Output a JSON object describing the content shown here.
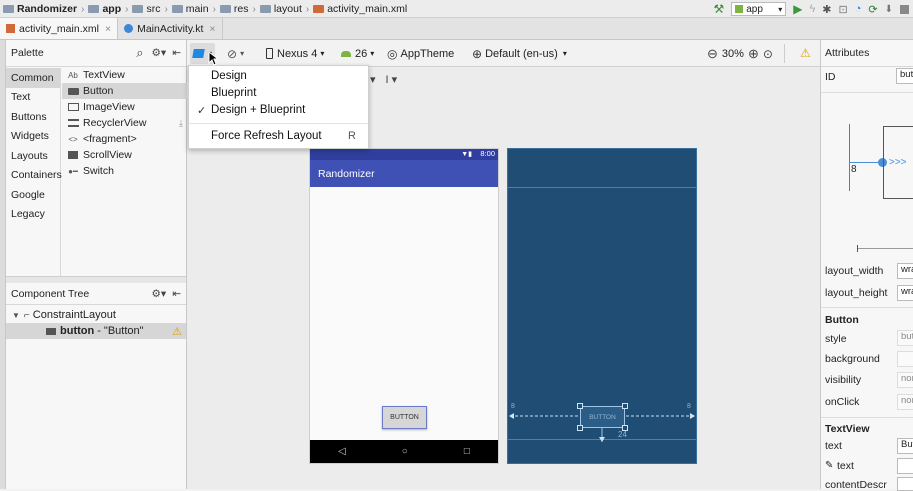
{
  "breadcrumbs": {
    "project": "Randomizer",
    "app": "app",
    "src": "src",
    "main": "main",
    "res": "res",
    "layout": "layout",
    "file": "activity_main.xml"
  },
  "run_config": "app",
  "tabs": [
    {
      "label": "activity_main.xml",
      "active": true
    },
    {
      "label": "MainActivity.kt",
      "active": false
    }
  ],
  "palette": {
    "title": "Palette",
    "categories": [
      "Common",
      "Text",
      "Buttons",
      "Widgets",
      "Layouts",
      "Containers",
      "Google",
      "Legacy"
    ],
    "selected_category": "Common",
    "widgets": [
      {
        "icon": "Ab",
        "label": "TextView"
      },
      {
        "icon": "button-widget-icon",
        "label": "Button"
      },
      {
        "icon": "image-icon",
        "label": "ImageView"
      },
      {
        "icon": "list-icon",
        "label": "RecyclerView"
      },
      {
        "icon": "<>",
        "label": "<fragment>"
      },
      {
        "icon": "scroll-icon",
        "label": "ScrollView"
      },
      {
        "icon": "switch-icon",
        "label": "Switch"
      }
    ]
  },
  "component_tree": {
    "title": "Component Tree",
    "root": "ConstraintLayout",
    "child_id": "button",
    "child_text": "- \"Button\""
  },
  "toolbar": {
    "device": "Nexus 4",
    "api": "26",
    "theme": "AppTheme",
    "locale": "Default (en-us)",
    "zoom": "30%"
  },
  "view_menu": {
    "items": [
      "Design",
      "Blueprint",
      "Design + Blueprint"
    ],
    "checked": "Design + Blueprint",
    "refresh_label": "Force Refresh Layout",
    "refresh_shortcut": "R"
  },
  "phone": {
    "status_time": "8:00",
    "app_title": "Randomizer",
    "button_text": "BUTTON",
    "colors": {
      "action_bar": "#3f51b5",
      "status_bar": "#303f9f",
      "nav_bar": "#000000",
      "blueprint": "#1f4d73"
    }
  },
  "blueprint": {
    "button_text": "BUTTON",
    "left_margin": "8",
    "right_margin": "8",
    "bottom_margin": "24"
  },
  "attributes": {
    "title": "Attributes",
    "id_label": "ID",
    "id_value": "button",
    "inspector_margin": "8",
    "layout_width_label": "layout_width",
    "layout_width_value": "wrap_content",
    "layout_height_label": "layout_height",
    "layout_height_value": "wrap_content",
    "section_button": "Button",
    "style_label": "style",
    "style_value": "button",
    "background_label": "background",
    "visibility_label": "visibility",
    "visibility_value": "none",
    "onclick_label": "onClick",
    "onclick_value": "none",
    "section_textview": "TextView",
    "text_label": "text",
    "text_value": "Button",
    "text_tools_label": "text",
    "content_desc_label": "contentDescr"
  }
}
